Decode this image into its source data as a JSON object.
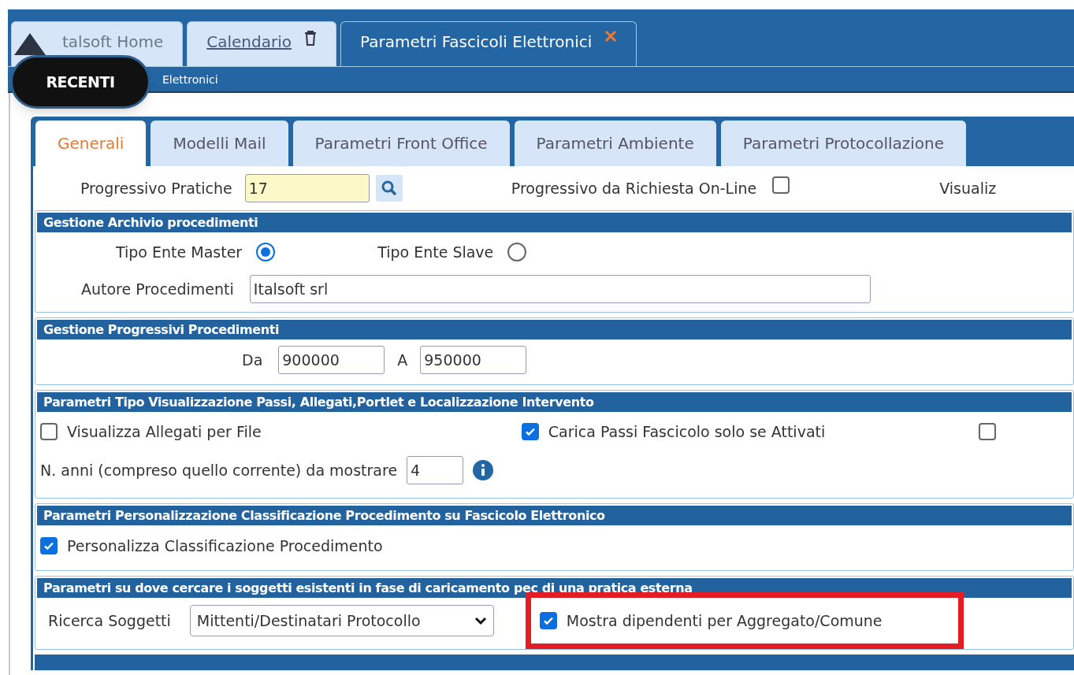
{
  "app_tabs": [
    {
      "label": "talsoft Home",
      "kind": "home",
      "selected": false
    },
    {
      "label": "Calendario",
      "kind": "link",
      "selected": false
    },
    {
      "label": "Parametri Fascicoli Elettronici",
      "kind": "closable",
      "selected": true
    }
  ],
  "breadcrumb": "Elettronici",
  "recent_badge": "RECENTI",
  "form_tabs": [
    {
      "label": "Generali",
      "selected": true
    },
    {
      "label": "Modelli Mail",
      "selected": false
    },
    {
      "label": "Parametri Front Office",
      "selected": false
    },
    {
      "label": "Parametri Ambiente",
      "selected": false
    },
    {
      "label": "Parametri Protocollazione",
      "selected": false
    }
  ],
  "top_row": {
    "label": "Progressivo Pratiche",
    "value": "17",
    "online_label": "Progressivo da Richiesta On-Line",
    "online_checked": false,
    "cut_label": "Visualiz"
  },
  "archivio": {
    "title": "Gestione Archivio procedimenti",
    "radios": [
      {
        "label": "Tipo Ente Master",
        "selected": true
      },
      {
        "label": "Tipo Ente Slave",
        "selected": false
      }
    ],
    "autore_label": "Autore Procedimenti",
    "autore_value": "Italsoft srl"
  },
  "progressivi": {
    "title": "Gestione Progressivi Procedimenti",
    "from_label": "Da",
    "from_value": "900000",
    "to_label": "A",
    "to_value": "950000"
  },
  "visualizzazione": {
    "title": "Parametri Tipo Visualizzazione Passi, Allegati,Portlet e Localizzazione Intervento",
    "checks": [
      {
        "label": "Visualizza Allegati per File",
        "checked": false
      },
      {
        "label": "Carica Passi Fascicolo solo se Attivati",
        "checked": true
      },
      {
        "checked": false
      }
    ],
    "anni_label": "N. anni (compreso quello corrente) da mostrare",
    "anni_value": "4"
  },
  "personalizzazione": {
    "title": "Parametri Personalizzazione Classificazione Procedimento su Fascicolo Elettronico",
    "check": {
      "label": "Personalizza Classificazione Procedimento",
      "checked": true
    }
  },
  "soggetti": {
    "title": "Parametri su dove cercare i soggetti esistenti in fase di caricamento pec di una pratica esterna",
    "select_label": "Ricerca Soggetti",
    "select_value": "Mittenti/Destinatari Protocollo",
    "check": {
      "label": "Mostra dipendenti per Aggregato/Comune",
      "checked": true,
      "highlighted": true
    }
  }
}
